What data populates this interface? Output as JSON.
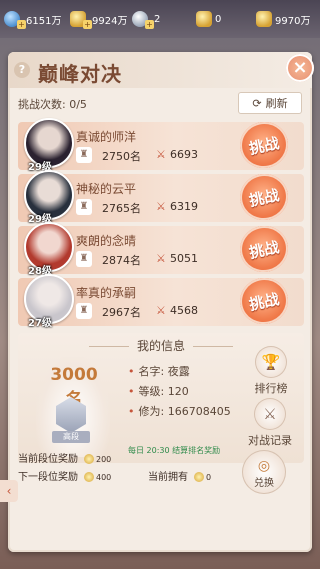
{
  "resources": [
    {
      "icon": "blue-gem-icon",
      "value": "6151万"
    },
    {
      "icon": "gold-ingot-icon",
      "value": "9924万"
    },
    {
      "icon": "silver-token-icon",
      "value": "2"
    },
    {
      "icon": "gold-ingot-icon",
      "value": "0"
    },
    {
      "icon": "gold-ingot-icon",
      "value": "9970万"
    }
  ],
  "header": {
    "title": "巅峰对决",
    "help": "?",
    "close": "×"
  },
  "challenge": {
    "label": "挑战次数: 0/5",
    "refresh": "刷新"
  },
  "opponents": [
    {
      "name": "真诚的师洋",
      "level": "29级",
      "rank": "2750名",
      "power": "6693",
      "fight": "挑战"
    },
    {
      "name": "神秘的云平",
      "level": "29级",
      "rank": "2765名",
      "power": "6319",
      "fight": "挑战"
    },
    {
      "name": "爽朗的念晴",
      "level": "28级",
      "rank": "2874名",
      "power": "5051",
      "fight": "挑战"
    },
    {
      "name": "率真的承嗣",
      "level": "27级",
      "rank": "2967名",
      "power": "4568",
      "fight": "挑战"
    }
  ],
  "myinfo": {
    "title": "我的信息",
    "rank": "3000名",
    "badge": "高段",
    "name": "名字: 夜露",
    "level": "等级: 120",
    "power": "修为: 166708405",
    "daily": "每日 20:30 结算排名奖励"
  },
  "side": {
    "ranking": "排行榜",
    "record": "对战记录",
    "exchange": "兑换"
  },
  "rewards": {
    "current_label": "当前段位奖励",
    "current_value": "200",
    "next_label": "下一段位奖励",
    "next_value": "400",
    "own_label": "当前拥有",
    "own_value": "0"
  },
  "colors": {
    "accent": "#f07a4a",
    "title": "#7a4a33",
    "panel": "#f4ece4"
  }
}
